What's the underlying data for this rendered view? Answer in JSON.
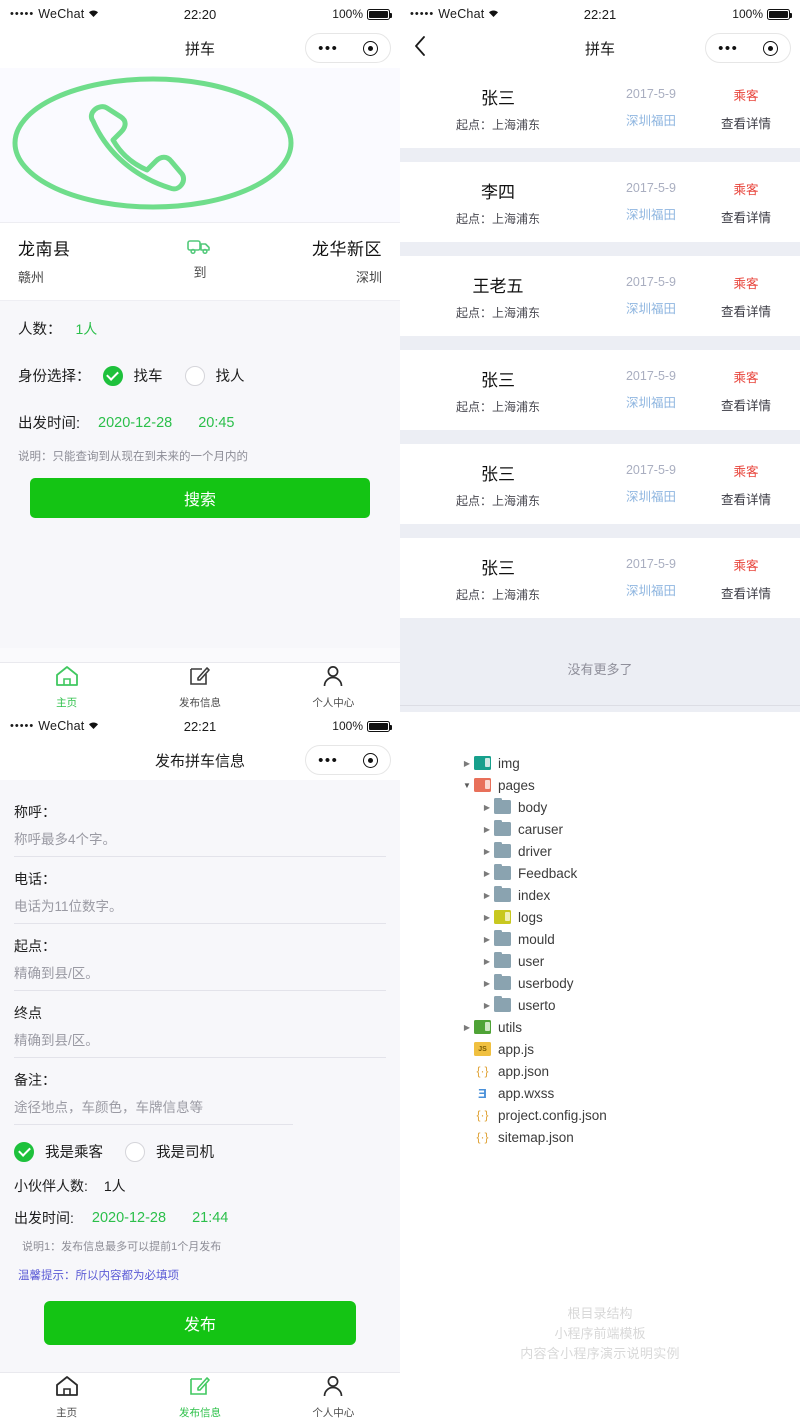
{
  "colors": {
    "green": "#14c414",
    "light_green": "#2bbf4a",
    "red_tag": "#e8453c",
    "blue_tip": "#5b5bd6",
    "dest_blue": "#8fb6e0"
  },
  "panel_search": {
    "statusbar": {
      "dots": "•••••",
      "carrier": "WeChat",
      "wifi": "⌃",
      "time": "22:20",
      "battery": "100%"
    },
    "navbar": {
      "title": "拼车",
      "menu_dots": "•••"
    },
    "hero": {
      "icon": "phone-circle-icon"
    },
    "route": {
      "origin_name": "龙南县",
      "origin_sub": "赣州",
      "middle_icon": "truck-icon",
      "middle_label": "到",
      "dest_name": "龙华新区",
      "dest_sub": "深圳"
    },
    "people": {
      "label": "人数：",
      "value": "1人"
    },
    "identity": {
      "label": "身份选择：",
      "option_car": "找车",
      "option_person": "找人",
      "selected": "找车"
    },
    "departure": {
      "label": "出发时间:",
      "date": "2020-12-28",
      "time": "20:45"
    },
    "note": "说明：只能查询到从现在到未来的一个月内的",
    "search_button": "搜索",
    "tabbar": [
      {
        "icon": "home-icon",
        "label": "主页",
        "active": true
      },
      {
        "icon": "edit-square-icon",
        "label": "发布信息",
        "active": false
      },
      {
        "icon": "person-icon",
        "label": "个人中心",
        "active": false
      }
    ]
  },
  "panel_list": {
    "statusbar": {
      "dots": "•••••",
      "carrier": "WeChat",
      "wifi": "⌃",
      "time": "22:21",
      "battery": "100%"
    },
    "navbar": {
      "title": "拼车",
      "back_icon": "chevron-left-icon",
      "menu_dots": "•••"
    },
    "rows": [
      {
        "name": "张三",
        "from": "起点：上海浦东",
        "date": "2017-5-9",
        "dest": "深圳福田",
        "tag": "乘客",
        "detail": "查看详情"
      },
      {
        "name": "李四",
        "from": "起点：上海浦东",
        "date": "2017-5-9",
        "dest": "深圳福田",
        "tag": "乘客",
        "detail": "查看详情"
      },
      {
        "name": "王老五",
        "from": "起点：上海浦东",
        "date": "2017-5-9",
        "dest": "深圳福田",
        "tag": "乘客",
        "detail": "查看详情"
      },
      {
        "name": "张三",
        "from": "起点：上海浦东",
        "date": "2017-5-9",
        "dest": "深圳福田",
        "tag": "乘客",
        "detail": "查看详情"
      },
      {
        "name": "张三",
        "from": "起点：上海浦东",
        "date": "2017-5-9",
        "dest": "深圳福田",
        "tag": "乘客",
        "detail": "查看详情"
      },
      {
        "name": "张三",
        "from": "起点：上海浦东",
        "date": "2017-5-9",
        "dest": "深圳福田",
        "tag": "乘客",
        "detail": "查看详情"
      }
    ],
    "no_more": "没有更多了"
  },
  "panel_publish": {
    "statusbar": {
      "dots": "•••••",
      "carrier": "WeChat",
      "wifi": "⌃",
      "time": "22:21",
      "battery": "100%"
    },
    "navbar": {
      "title": "发布拼车信息",
      "menu_dots": "•••"
    },
    "fields": [
      {
        "label": "称呼：",
        "placeholder": "称呼最多4个字。"
      },
      {
        "label": "电话：",
        "placeholder": "电话为11位数字。"
      },
      {
        "label": "起点：",
        "placeholder": "精确到县/区。"
      },
      {
        "label": "终点",
        "placeholder": "精确到县/区。"
      },
      {
        "label": "备注：",
        "placeholder": "途径地点，车颜色，车牌信息等"
      }
    ],
    "role": {
      "option_passenger": "我是乘客",
      "option_driver": "我是司机",
      "selected": "我是乘客"
    },
    "partners": {
      "label": "小伙伴人数:",
      "value": "1人"
    },
    "departure": {
      "label": "出发时间:",
      "date": "2020-12-28",
      "time": "21:44"
    },
    "note1": "说明1：发布信息最多可以提前1个月发布",
    "tip": "温馨提示：所以内容都为必填项",
    "publish_button": "发布",
    "tabbar": [
      {
        "icon": "home-icon",
        "label": "主页",
        "active": false
      },
      {
        "icon": "edit-square-icon",
        "label": "发布信息",
        "active": true
      },
      {
        "icon": "person-icon",
        "label": "个人中心",
        "active": false
      }
    ]
  },
  "panel_tree": {
    "nodes": [
      {
        "depth": 0,
        "arrow": "▶",
        "icon": "folder-img",
        "name": "img"
      },
      {
        "depth": 0,
        "arrow": "▼",
        "icon": "folder-pages",
        "name": "pages"
      },
      {
        "depth": 1,
        "arrow": "▶",
        "icon": "folder",
        "name": "body"
      },
      {
        "depth": 1,
        "arrow": "▶",
        "icon": "folder",
        "name": "caruser"
      },
      {
        "depth": 1,
        "arrow": "▶",
        "icon": "folder",
        "name": "driver"
      },
      {
        "depth": 1,
        "arrow": "▶",
        "icon": "folder",
        "name": "Feedback"
      },
      {
        "depth": 1,
        "arrow": "▶",
        "icon": "folder",
        "name": "index"
      },
      {
        "depth": 1,
        "arrow": "▶",
        "icon": "folder-logs",
        "name": "logs"
      },
      {
        "depth": 1,
        "arrow": "▶",
        "icon": "folder",
        "name": "mould"
      },
      {
        "depth": 1,
        "arrow": "▶",
        "icon": "folder",
        "name": "user"
      },
      {
        "depth": 1,
        "arrow": "▶",
        "icon": "folder",
        "name": "userbody"
      },
      {
        "depth": 1,
        "arrow": "▶",
        "icon": "folder",
        "name": "userto"
      },
      {
        "depth": 0,
        "arrow": "▶",
        "icon": "folder-utils",
        "name": "utils"
      },
      {
        "depth": 0,
        "arrow": "",
        "icon": "js",
        "name": "app.js"
      },
      {
        "depth": 0,
        "arrow": "",
        "icon": "json",
        "name": "app.json"
      },
      {
        "depth": 0,
        "arrow": "",
        "icon": "wxss",
        "name": "app.wxss"
      },
      {
        "depth": 0,
        "arrow": "",
        "icon": "json",
        "name": "project.config.json"
      },
      {
        "depth": 0,
        "arrow": "",
        "icon": "json",
        "name": "sitemap.json"
      }
    ],
    "watermark": [
      "根目录结构",
      "小程序前端模板",
      "内容含小程序演示说明实例"
    ]
  }
}
